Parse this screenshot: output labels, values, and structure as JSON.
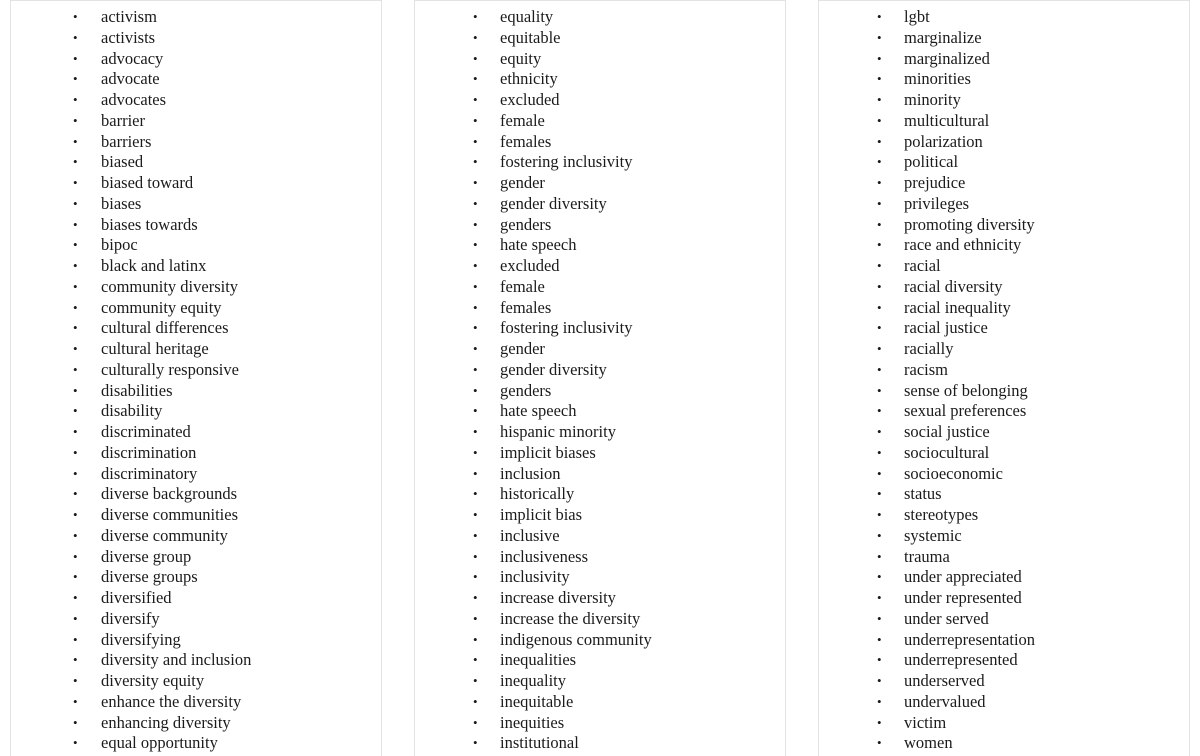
{
  "document": {
    "layout": "three-column-bulleted-term-lists",
    "bullet_glyph": "•",
    "text_color": "#1b1b1b",
    "border_color": "#e3e3e3",
    "background_color": "#ffffff"
  },
  "columns": [
    {
      "name": "column-one",
      "items": [
        "activism",
        "activists",
        "advocacy",
        "advocate",
        "advocates",
        "barrier",
        "barriers",
        "biased",
        "biased toward",
        "biases",
        "biases towards",
        "bipoc",
        "black and latinx",
        "community diversity",
        "community equity",
        "cultural differences",
        "cultural heritage",
        "culturally responsive",
        "disabilities",
        "disability",
        "discriminated",
        "discrimination",
        "discriminatory",
        "diverse backgrounds",
        "diverse communities",
        "diverse community",
        "diverse group",
        "diverse groups",
        "diversified",
        "diversify",
        "diversifying",
        "diversity and inclusion",
        "diversity equity",
        "enhance the diversity",
        "enhancing diversity",
        "equal opportunity"
      ]
    },
    {
      "name": "column-two",
      "items": [
        "equality",
        "equitable",
        "equity",
        "ethnicity",
        "excluded",
        "female",
        "females",
        "fostering inclusivity",
        "gender",
        "gender diversity",
        "genders",
        "hate speech",
        "excluded",
        "female",
        "females",
        "fostering inclusivity",
        "gender",
        "gender diversity",
        "genders",
        "hate speech",
        "hispanic minority",
        "implicit biases",
        "inclusion",
        "historically",
        "implicit bias",
        "inclusive",
        "inclusiveness",
        "inclusivity",
        "increase diversity",
        "increase the diversity",
        "indigenous community",
        "inequalities",
        "inequality",
        "inequitable",
        "inequities",
        "institutional"
      ]
    },
    {
      "name": "column-three",
      "items": [
        "lgbt",
        "marginalize",
        "marginalized",
        "minorities",
        "minority",
        "multicultural",
        "polarization",
        "political",
        "prejudice",
        "privileges",
        "promoting diversity",
        "race and ethnicity",
        "racial",
        "racial diversity",
        "racial inequality",
        "racial justice",
        "racially",
        "racism",
        "sense of belonging",
        "sexual preferences",
        "social justice",
        "sociocultural",
        "socioeconomic",
        "status",
        "stereotypes",
        "systemic",
        "trauma",
        "under appreciated",
        "under represented",
        "under served",
        "underrepresentation",
        "underrepresented",
        "underserved",
        "undervalued",
        "victim",
        "women"
      ]
    }
  ]
}
